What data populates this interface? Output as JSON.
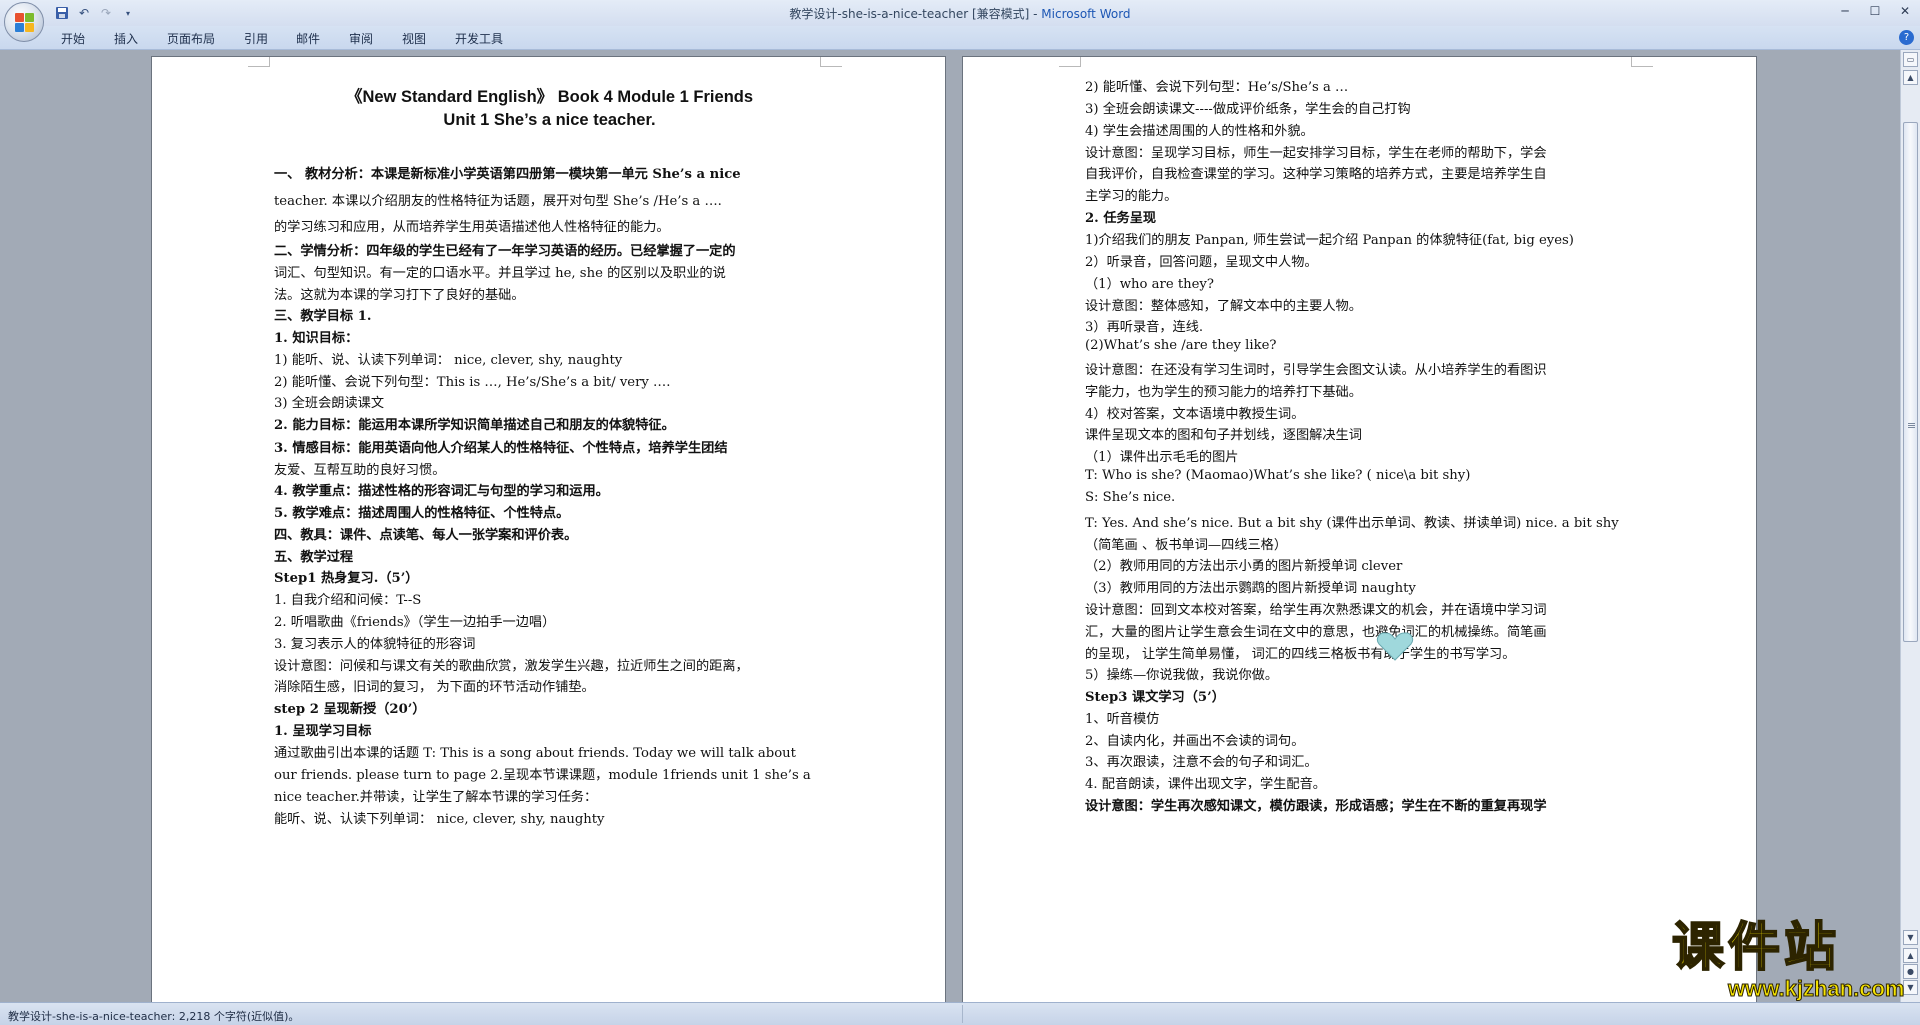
{
  "window": {
    "title_doc": "教学设计-she-is-a-nice-teacher [兼容模式] - ",
    "title_app": "Microsoft Word"
  },
  "ribbon": {
    "tabs": [
      "开始",
      "插入",
      "页面布局",
      "引用",
      "邮件",
      "审阅",
      "视图",
      "开发工具"
    ]
  },
  "document": {
    "left_page": [
      "《New Standard English》 Book 4 Module 1 Friends",
      "Unit 1 She’s a nice teacher.",
      "一、 教材分析：本课是新标准小学英语第四册第一模块第一单元 She’s a nice",
      "teacher. 本课以介绍朋友的性格特征为话题，展开对句型 She’s /He’s a ….",
      "的学习练习和应用，从而培养学生用英语描述他人性格特征的能力。",
      "二、学情分析：四年级的学生已经有了一年学习英语的经历。已经掌握了一定的",
      "词汇、句型知识。有一定的口语水平。并且学过 he, she 的区别以及职业的说",
      "法。这就为本课的学习打下了良好的基础。",
      "三、教学目标 1.",
      "1. 知识目标：",
      "1) 能听、说、认读下列单词： nice, clever, shy, naughty",
      "2) 能听懂、会说下列句型：This is …, He’s/She’s a bit/ very ….",
      "3) 全班会朗读课文",
      "2. 能力目标：能运用本课所学知识简单描述自己和朋友的体貌特征。",
      "3. 情感目标：能用英语向他人介绍某人的性格特征、个性特点，培养学生团结",
      "友爱、互帮互助的良好习惯。",
      "4. 教学重点：描述性格的形容词汇与句型的学习和运用。",
      "5. 教学难点：描述周围人的性格特征、个性特点。",
      "四、教具：课件、点读笔、每人一张学案和评价表。",
      "五、教学过程",
      "Step1 热身复习.（5’）",
      "1. 自我介绍和问候：T--S",
      "2. 听唱歌曲《friends》（学生一边拍手一边唱）",
      "3. 复习表示人的体貌特征的形容词",
      "设计意图：问候和与课文有关的歌曲欣赏，激发学生兴趣，拉近师生之间的距离，",
      "消除陌生感，旧词的复习， 为下面的环节活动作铺垫。",
      "step 2 呈现新授（20’）",
      "1. 呈现学习目标",
      "通过歌曲引出本课的话题 T: This is a song about friends. Today we will talk about",
      "our friends. please turn to page 2.呈现本节课课题，module 1friends unit 1 she’s a",
      "nice teacher.并带读，让学生了解本节课的学习任务：",
      "能听、说、认读下列单词： nice, clever, shy, naughty"
    ],
    "right_page": [
      "2) 能听懂、会说下列句型：He’s/She’s a …",
      "3) 全班会朗读课文----做成评价纸条，学生会的自己打钩",
      "4) 学生会描述周围的人的性格和外貌。",
      "设计意图：呈现学习目标，师生一起安排学习目标，学生在老师的帮助下，学会",
      "自我评价，自我检查课堂的学习。这种学习策略的培养方式，主要是培养学生自",
      "主学习的能力。",
      "2. 任务呈现",
      "1)介绍我们的朋友 Panpan, 师生尝试一起介绍 Panpan 的体貌特征(fat, big eyes)",
      "2）听录音，回答问题，呈现文中人物。",
      "（1）who are they?",
      "设计意图：整体感知，了解文本中的主要人物。",
      "3）再听录音，连线.",
      "(2)What’s she /are they like?",
      "设计意图：在还没有学习生词时，引导学生会图文认读。从小培养学生的看图识",
      "字能力，也为学生的预习能力的培养打下基础。",
      "4）校对答案，文本语境中教授生词。",
      "课件呈现文本的图和句子并划线，逐图解决生词",
      "（1）课件出示毛毛的图片",
      "T: Who is she? (Maomao)What’s she like? ( nice\\a bit shy)",
      "S: She’s nice.",
      "T: Yes. And she’s nice. But a bit shy (课件出示单词、教读、拼读单词) nice. a bit shy",
      "（简笔画 、板书单词—四线三格）",
      "（2）教师用同的方法出示小勇的图片新授单词 clever",
      "（3）教师用同的方法出示鹦鹉的图片新授单词 naughty",
      "设计意图：回到文本校对答案，给学生再次熟悉课文的机会，并在语境中学习词",
      "汇，大量的图片让学生意会生词在文中的意思，也避免词汇的机械操练。简笔画",
      "的呈现， 让学生简单易懂， 词汇的四线三格板书有助于学生的书写学习。",
      "5）操练—你说我做，我说你做。",
      "Step3 课文学习（5’）",
      "1、听音模仿",
      "2、自读内化，并画出不会读的词句。",
      "3、再次跟读，注意不会的句子和词汇。",
      "4. 配音朗读，课件出现文字，学生配音。",
      "设计意图：学生再次感知课文，模仿跟读，形成语感；学生在不断的重复再现学"
    ]
  },
  "status": {
    "text": "教学设计-she-is-a-nice-teacher: 2,218 个字符(近似值)。"
  },
  "watermark": {
    "main": "课件站",
    "url": "www.kjzhan.com"
  },
  "icons": {
    "office_button": "office-logo-icon",
    "qat": [
      "save-icon",
      "undo-icon",
      "redo-icon",
      "customize-qat-icon"
    ],
    "window_controls": [
      "minimize-icon",
      "maximize-icon",
      "close-icon"
    ],
    "help": "help-icon",
    "drawing": "heart-icon"
  },
  "colors": {
    "title_app": "#1c56b4",
    "watermark": "#f6e400",
    "heart": "#9fd8dc"
  }
}
